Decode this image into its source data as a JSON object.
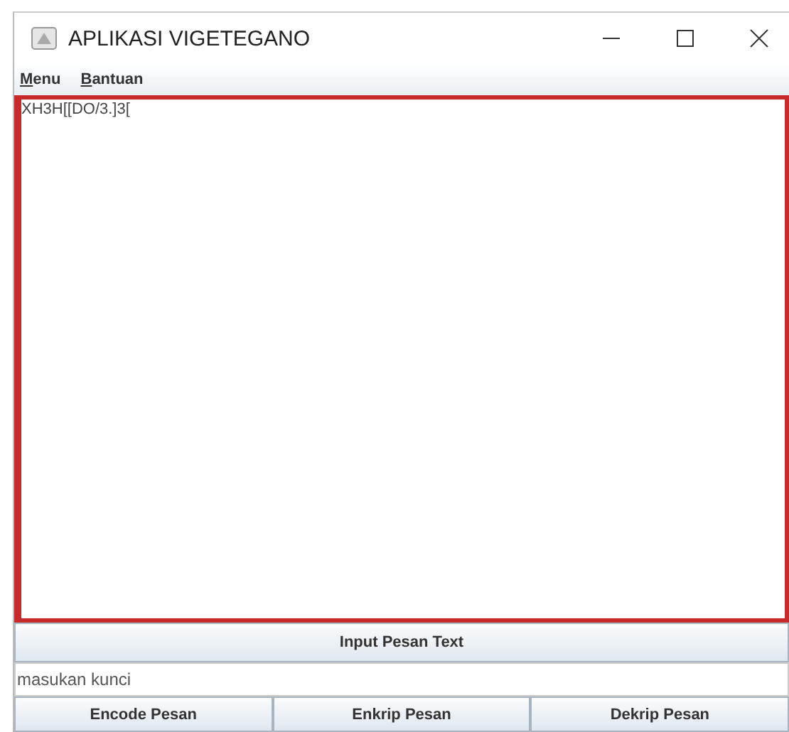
{
  "window": {
    "title": "APLIKASI VIGETEGANO"
  },
  "menu": [
    "Menu",
    "Bantuan"
  ],
  "message_area": {
    "value": "XH3H[[DO/3.]3["
  },
  "input_button": "Input Pesan Text",
  "key_field": {
    "value": "masukan kunci"
  },
  "buttons": [
    "Encode Pesan",
    "Enkrip Pesan",
    "Dekrip Pesan"
  ]
}
